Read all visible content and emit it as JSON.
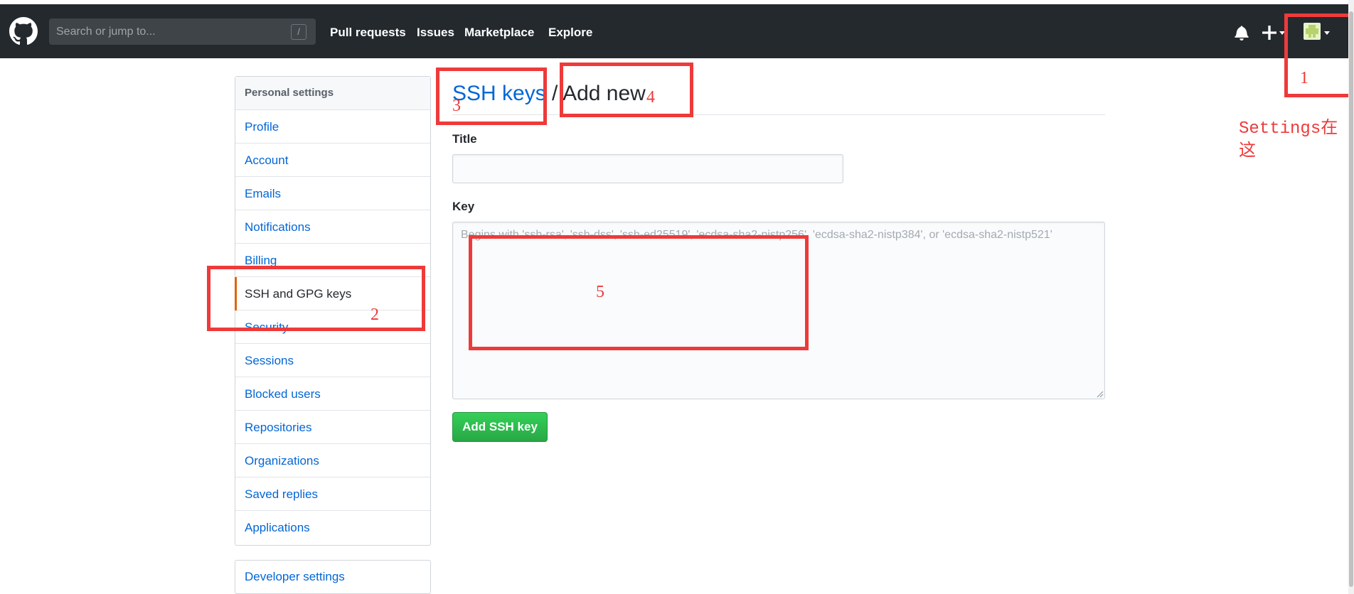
{
  "header": {
    "search_placeholder": "Search or jump to...",
    "search_shortcut": "/",
    "nav": [
      "Pull requests",
      "Issues",
      "Marketplace",
      "Explore"
    ]
  },
  "sidebar": {
    "heading": "Personal settings",
    "items": [
      {
        "label": "Profile"
      },
      {
        "label": "Account"
      },
      {
        "label": "Emails"
      },
      {
        "label": "Notifications"
      },
      {
        "label": "Billing"
      },
      {
        "label": "SSH and GPG keys",
        "selected": true
      },
      {
        "label": "Security"
      },
      {
        "label": "Sessions"
      },
      {
        "label": "Blocked users"
      },
      {
        "label": "Repositories"
      },
      {
        "label": "Organizations"
      },
      {
        "label": "Saved replies"
      },
      {
        "label": "Applications"
      }
    ],
    "developer_settings": "Developer settings"
  },
  "main": {
    "breadcrumb_link": "SSH keys",
    "breadcrumb_sep": " / ",
    "breadcrumb_current": "Add new",
    "title_label": "Title",
    "title_value": "",
    "key_label": "Key",
    "key_placeholder": "Begins with 'ssh-rsa', 'ssh-dss', 'ssh-ed25519', 'ecdsa-sha2-nistp256', 'ecdsa-sha2-nistp384', or 'ecdsa-sha2-nistp521'",
    "submit_label": "Add SSH key"
  },
  "annotations": {
    "n1": "1",
    "n2": "2",
    "n3": "3",
    "n4": "4",
    "n5": "5",
    "note": "Settings在这"
  },
  "colors": {
    "header_bg": "#24292e",
    "link": "#0366d6",
    "selected_accent": "#e36209",
    "button_green": "#28a745",
    "annotation_red": "#ee3a3a"
  },
  "icons": [
    "github-logo-icon",
    "bell-icon",
    "plus-icon",
    "chevron-down-icon",
    "avatar",
    "resize-grip-icon"
  ]
}
